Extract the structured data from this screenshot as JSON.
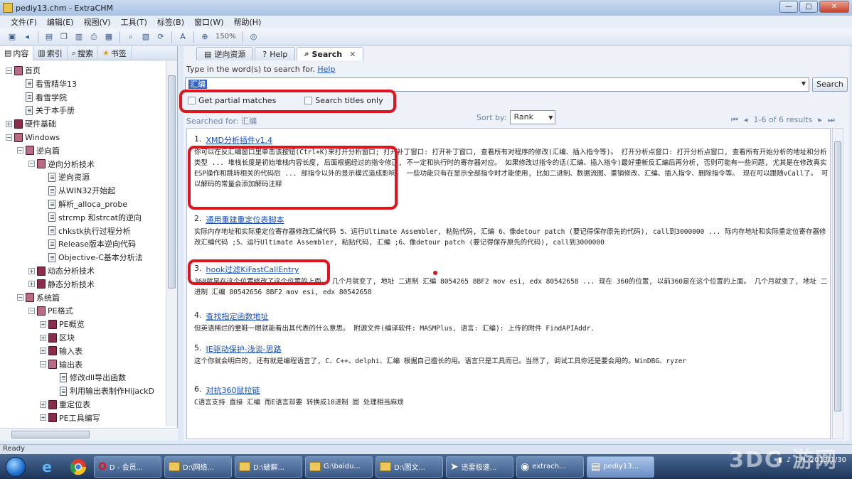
{
  "window": {
    "title": "pediy13.chm - ExtraCHM",
    "controls": [
      "—",
      "□",
      "✕"
    ]
  },
  "menu": [
    "文件(F)",
    "编辑(E)",
    "视图(V)",
    "工具(T)",
    "标签(B)",
    "窗口(W)",
    "帮助(H)"
  ],
  "toolbar": {
    "zoom": "150%"
  },
  "left_panel": {
    "tabs": [
      {
        "label": "内容",
        "icon": "contents-icon"
      },
      {
        "label": "索引",
        "icon": "index-icon"
      },
      {
        "label": "搜索",
        "icon": "search-icon"
      },
      {
        "label": "书签",
        "icon": "bookmark-icon"
      }
    ],
    "tree": [
      {
        "label": "首页",
        "level": 0,
        "type": "book-open",
        "toggle": "−"
      },
      {
        "label": "看雪精华13",
        "level": 1,
        "type": "page"
      },
      {
        "label": "看雪学院",
        "level": 1,
        "type": "page"
      },
      {
        "label": "关于本手册",
        "level": 1,
        "type": "page"
      },
      {
        "label": "硬件基础",
        "level": 0,
        "type": "book",
        "toggle": "+"
      },
      {
        "label": "Windows",
        "level": 0,
        "type": "book-open",
        "toggle": "−"
      },
      {
        "label": "逆向篇",
        "level": 1,
        "type": "book-open",
        "toggle": "−"
      },
      {
        "label": "逆向分析技术",
        "level": 2,
        "type": "book-open",
        "toggle": "−"
      },
      {
        "label": "逆向资源",
        "level": 3,
        "type": "page"
      },
      {
        "label": "从WIN32开始起",
        "level": 3,
        "type": "page"
      },
      {
        "label": "解析_alloca_probe",
        "level": 3,
        "type": "page"
      },
      {
        "label": "strcmp 和strcat的逆向",
        "level": 3,
        "type": "page"
      },
      {
        "label": "chkstk执行过程分析",
        "level": 3,
        "type": "page"
      },
      {
        "label": "Release版本逆向代码",
        "level": 3,
        "type": "page"
      },
      {
        "label": "Objective-C基本分析法",
        "level": 3,
        "type": "page"
      },
      {
        "label": "动态分析技术",
        "level": 2,
        "type": "book",
        "toggle": "+"
      },
      {
        "label": "静态分析技术",
        "level": 2,
        "type": "book",
        "toggle": "+"
      },
      {
        "label": "系统篇",
        "level": 1,
        "type": "book-open",
        "toggle": "−"
      },
      {
        "label": "PE格式",
        "level": 2,
        "type": "book-open",
        "toggle": "−"
      },
      {
        "label": "PE概览",
        "level": 3,
        "type": "book",
        "toggle": "+"
      },
      {
        "label": "区块",
        "level": 3,
        "type": "book",
        "toggle": "+"
      },
      {
        "label": "输入表",
        "level": 3,
        "type": "book",
        "toggle": "+"
      },
      {
        "label": "输出表",
        "level": 3,
        "type": "book-open",
        "toggle": "−"
      },
      {
        "label": "修改dll导出函数",
        "level": 4,
        "type": "page"
      },
      {
        "label": "利用输出表制作HijackD",
        "level": 4,
        "type": "page"
      },
      {
        "label": "重定位表",
        "level": 3,
        "type": "book",
        "toggle": "+"
      },
      {
        "label": "PE工具编写",
        "level": 3,
        "type": "book",
        "toggle": "+"
      },
      {
        "label": "PE文件加载",
        "level": 3,
        "type": "book",
        "toggle": "+"
      }
    ]
  },
  "right_panel": {
    "tabs": [
      {
        "label": "逆向资源",
        "icon": "page-icon"
      },
      {
        "label": "Help",
        "icon": "help-icon"
      },
      {
        "label": "Search",
        "icon": "search-icon",
        "active": true
      }
    ],
    "prompt": "Type in the word(s) to search for.",
    "prompt_help": "Help",
    "query": "汇编",
    "search_button": "Search",
    "partial_matches_label": "Get partial matches",
    "titles_only_label": "Search titles only",
    "searched_for": "Searched for: 汇编",
    "sort_label": "Sort by:",
    "sort_value": "Rank",
    "results_count": "1-6 of 6 results",
    "results": [
      {
        "num": "1.",
        "title": "XMD分析插件v1.4",
        "snippet": "你可以在反汇编窗口里单击该按钮(Ctrl+K)来打开分析窗口; 打开补丁窗口: 打开补丁窗口, 查看所有对程序的修改(汇编、插入指令等)。 打开分析点窗口: 打开分析点窗口, 查看所有开始分析的地址和分析类型 ... 堆栈长度是初始堆栈内容长度, 后面根据经过的指令修正, 不一定和执行时的寄存器对应。 如果修改过指令的话(汇编、插入指令)最好重新反汇编后再分析, 否则可能有一些问题, 尤其是在修改真实ESP操作和跳转相关的代码后 ... 部指令以外的显示模式造成影响。 一些功能只有在显示全部指令时才能使用, 比如二进制、数据流图、重销修改、汇编、插入指令、删除指令等。 现在可以跟随vCall了。 可以解码的常量会添加解码注释"
      },
      {
        "num": "2.",
        "title": "通用重建重定位表脚本",
        "snippet": "实际内存地址和实际重定位寄存器修改汇编代码 5、运行Ultimate Assembler, 粘贴代码, 汇编 6、像detour patch (要记得保存原先的代码), call到3000000 ... 际内存地址和实际重定位寄存器修改汇编代码 ;5、运行Ultimate Assembler, 粘贴代码, 汇编 ;6、像detour patch (要记得保存原先的代码), call到3000000"
      },
      {
        "num": "3.",
        "title": "hook过滤KiFastCallEntry",
        "snippet": "360就是在这个位置修改了这个位置的上面。 几个月就变了, 地址 二进制 汇编 8054265 8BF2 mov esi, edx 80542658 ... 现在 360的位置, 以前360是在这个位置的上面。 几个月就变了, 地址 二进制 汇编 80542656 8BF2 mov esi, edx 80542658"
      },
      {
        "num": "4.",
        "title": "查找指定函数地址",
        "snippet": "但英语稀烂的童鞋一眼就能看出其代表的什么意思。 附源文件(编译软件: MASMPlus, 语言: 汇编): 上传的附件 FindAPIAddr."
      },
      {
        "num": "5.",
        "title": "IE驱动保护-浅谈-思路",
        "snippet": "这个你就会明白的, 还有就是编程语言了, C、C++、delphi、汇编 根据自己擅长的用。语言只是工具而已。当然了, 调试工具你还是要会用的。WinDBG、ryzer"
      },
      {
        "num": "6.",
        "title": "对抗360鼠拉链",
        "snippet": "C语言支持 直接 汇编 而E语言却要 转换成10进制 固 处理相当麻烦"
      }
    ]
  },
  "status": "Ready",
  "taskbar": {
    "tasks": [
      {
        "label": "D - 会员...",
        "icon": "opera-icon"
      },
      {
        "label": "D:\\网络...",
        "icon": "folder-icon"
      },
      {
        "label": "D:\\破解...",
        "icon": "folder-icon"
      },
      {
        "label": "G:\\baidu...",
        "icon": "folder-icon"
      },
      {
        "label": "D:\\图文...",
        "icon": "folder-icon"
      },
      {
        "label": "迅雷极速...",
        "icon": "thunder-icon"
      },
      {
        "label": "extrach...",
        "icon": "extrachm-icon"
      },
      {
        "label": "pediy13...",
        "icon": "chm-icon",
        "active": true
      }
    ],
    "date": "2013/1/30"
  },
  "watermark": "3DG 游网",
  "colors": {
    "highlight": "#e0141e",
    "link": "#1a4fb8"
  }
}
